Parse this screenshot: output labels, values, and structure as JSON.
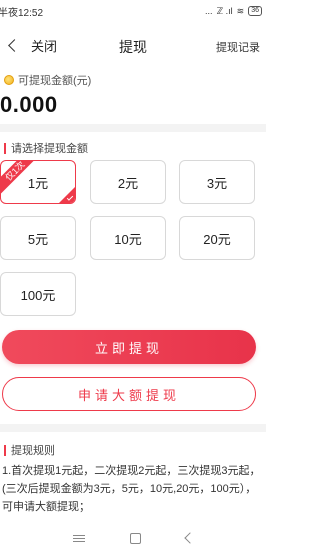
{
  "status_bar": {
    "time": "半夜12:52",
    "dots": "...",
    "signal_text": "ℤ .ıl",
    "wifi": "≋",
    "battery": "36"
  },
  "nav": {
    "back_label": "关闭",
    "title": "提现",
    "record_label": "提现记录"
  },
  "balance": {
    "label": "可提现金额(元)",
    "value": "0.000"
  },
  "select_section": {
    "title": "请选择提现金额"
  },
  "amounts": [
    {
      "label": "1元",
      "tag": "仅1次",
      "selected": true
    },
    {
      "label": "2元"
    },
    {
      "label": "3元"
    },
    {
      "label": "5元"
    },
    {
      "label": "10元"
    },
    {
      "label": "20元"
    },
    {
      "label": "100元"
    }
  ],
  "buttons": {
    "withdraw_now": "立即提现",
    "apply_large": "申请大额提现"
  },
  "rules": {
    "title": "提现规则",
    "text": "1.首次提现1元起，二次提现2元起，三次提现3元起，(三次后提现金额为3元，5元，10元,20元，100元），可申请大额提现；"
  },
  "colors": {
    "accent": "#ee3a4a",
    "coin": "#f2b21c"
  }
}
